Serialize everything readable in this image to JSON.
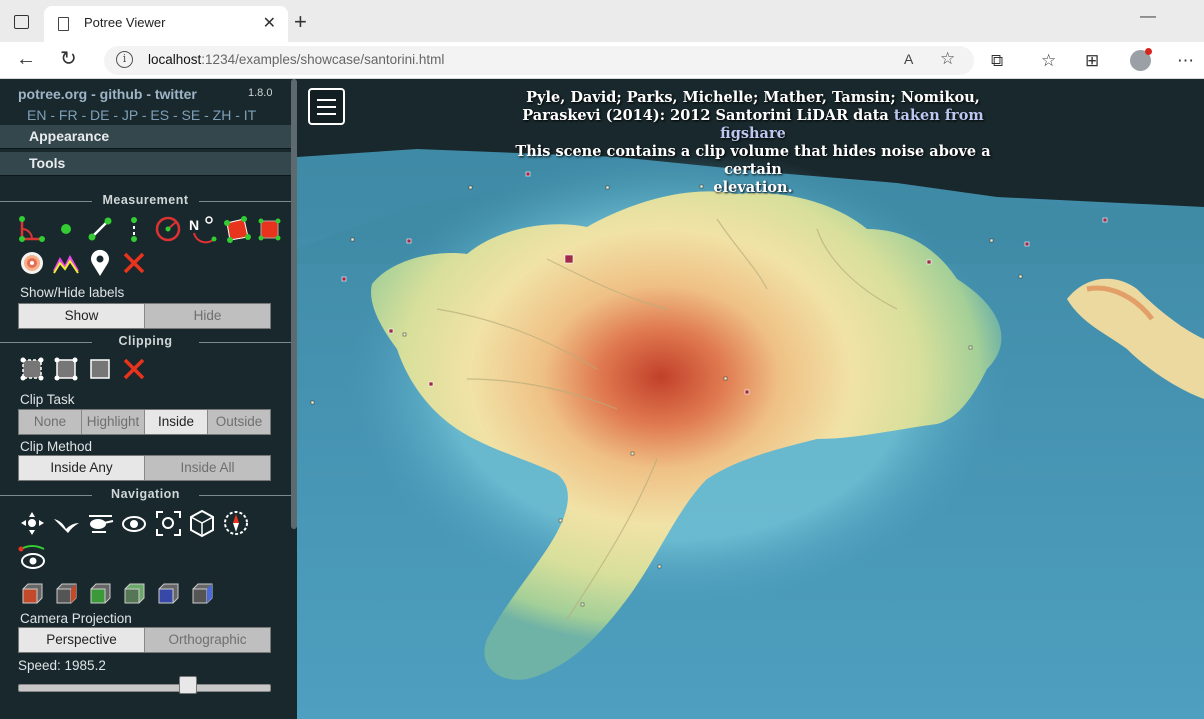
{
  "browser": {
    "tab_title": "Potree Viewer",
    "url_host": "localhost",
    "url_rest": ":1234/examples/showcase/santorini.html"
  },
  "sidebar": {
    "links": "potree.org - github - twitter",
    "version": "1.8.0",
    "languages": "EN - FR - DE - JP - ES - SE - ZH - IT",
    "appearance_label": "Appearance",
    "tools_label": "Tools",
    "measurement": {
      "title": "Measurement",
      "tools": [
        "angle-icon",
        "point-icon",
        "distance-icon",
        "height-icon",
        "circle-icon",
        "azimuth-icon",
        "area-icon",
        "volume-icon",
        "sphere-volume-icon",
        "height-profile-icon",
        "annotation-icon",
        "remove-all-measurements-icon"
      ],
      "labels_title": "Show/Hide labels",
      "show_label": "Show",
      "hide_label": "Hide"
    },
    "clipping": {
      "title": "Clipping",
      "clip_task_label": "Clip Task",
      "clip_tasks": [
        "None",
        "Highlight",
        "Inside",
        "Outside"
      ],
      "clip_task_selected": "Inside",
      "clip_method_label": "Clip Method",
      "clip_methods": [
        "Inside Any",
        "Inside All"
      ],
      "clip_method_selected": "Inside Any"
    },
    "navigation": {
      "title": "Navigation",
      "camera_projection_label": "Camera Projection",
      "projections": [
        "Perspective",
        "Orthographic"
      ],
      "projection_selected": "Perspective",
      "speed_label": "Speed: 1985.2",
      "speed_value": 1985.2
    }
  },
  "viewer": {
    "caption_line1": "Pyle, David; Parks, Michelle; Mather, Tamsin; Nomikou,",
    "caption_line2a": "Paraskevi (2014): 2012 Santorini LiDAR data ",
    "caption_link": "taken from figshare",
    "caption_line3": "This scene contains a clip volume that hides noise above a certain",
    "caption_line4": "elevation."
  }
}
